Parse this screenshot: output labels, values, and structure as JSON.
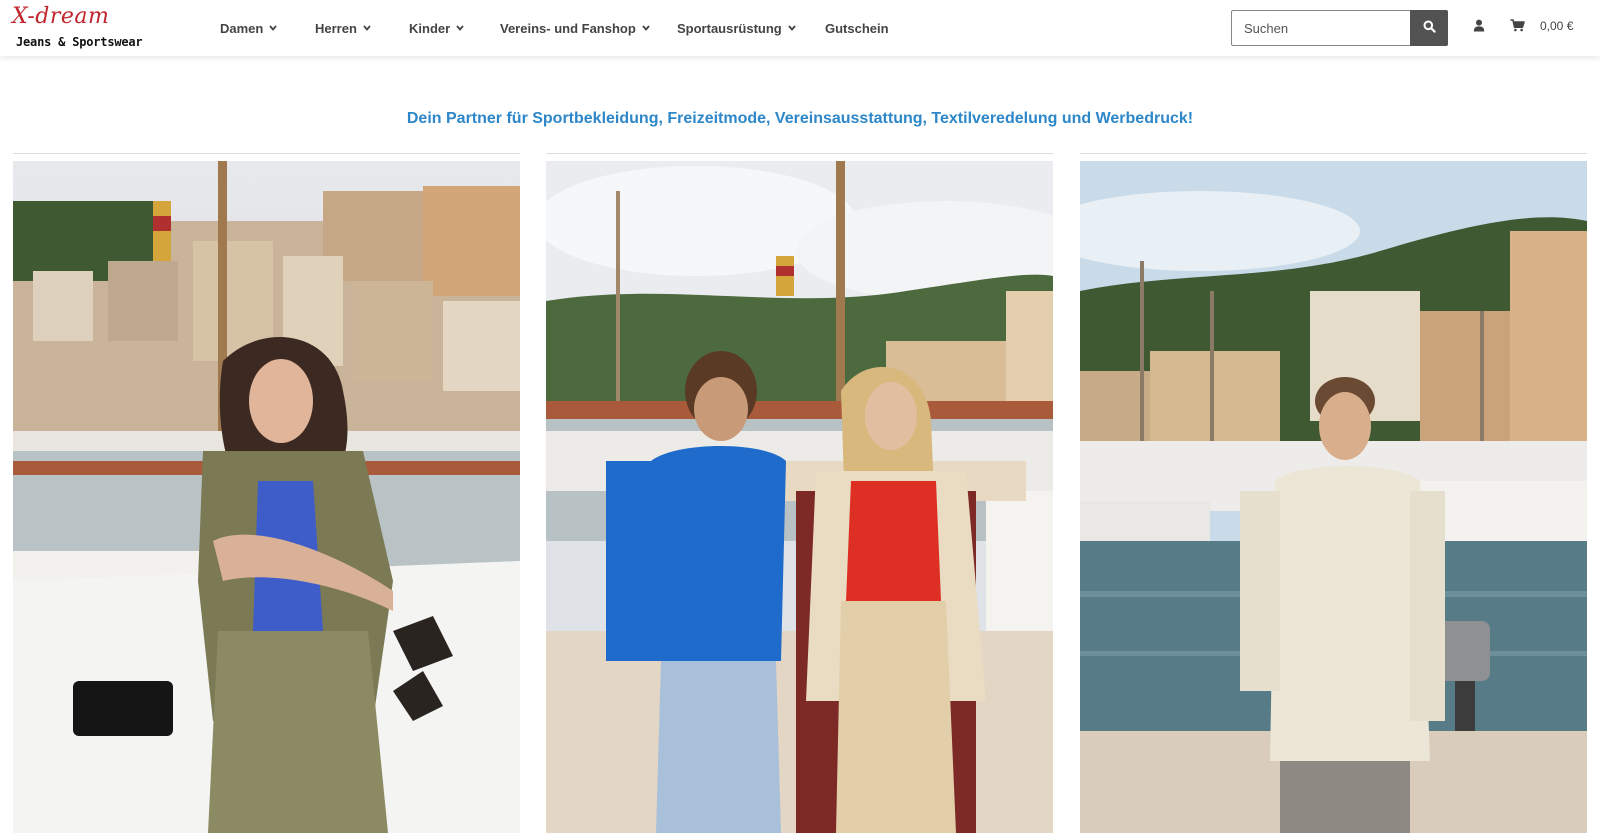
{
  "brand": {
    "logo_script": "X-dream",
    "logo_sub": "Jeans & Sportswear",
    "accent": "#c0262d"
  },
  "nav": {
    "items": [
      {
        "label": "Damen",
        "has_dropdown": true
      },
      {
        "label": "Herren",
        "has_dropdown": true
      },
      {
        "label": "Kinder",
        "has_dropdown": true
      },
      {
        "label": "Vereins- und Fanshop",
        "has_dropdown": true
      },
      {
        "label": "Sportausrüstung",
        "has_dropdown": true
      },
      {
        "label": "Gutschein",
        "has_dropdown": false
      }
    ]
  },
  "search": {
    "placeholder": "Suchen",
    "icon": "search-icon"
  },
  "header_icons": {
    "account": "user-icon",
    "cart": "cart-icon",
    "cart_total": "0,00 €"
  },
  "tagline": {
    "text": "Dein Partner für Sportbekleidung, Freizeitmode, Vereinsausstattung, Textilveredelung und Werbedruck!",
    "color": "#2d87c8"
  },
  "promo_tiles": [
    {
      "name": "damen-harbor-photo"
    },
    {
      "name": "kinder-harbor-photo"
    },
    {
      "name": "herren-harbor-photo"
    }
  ]
}
